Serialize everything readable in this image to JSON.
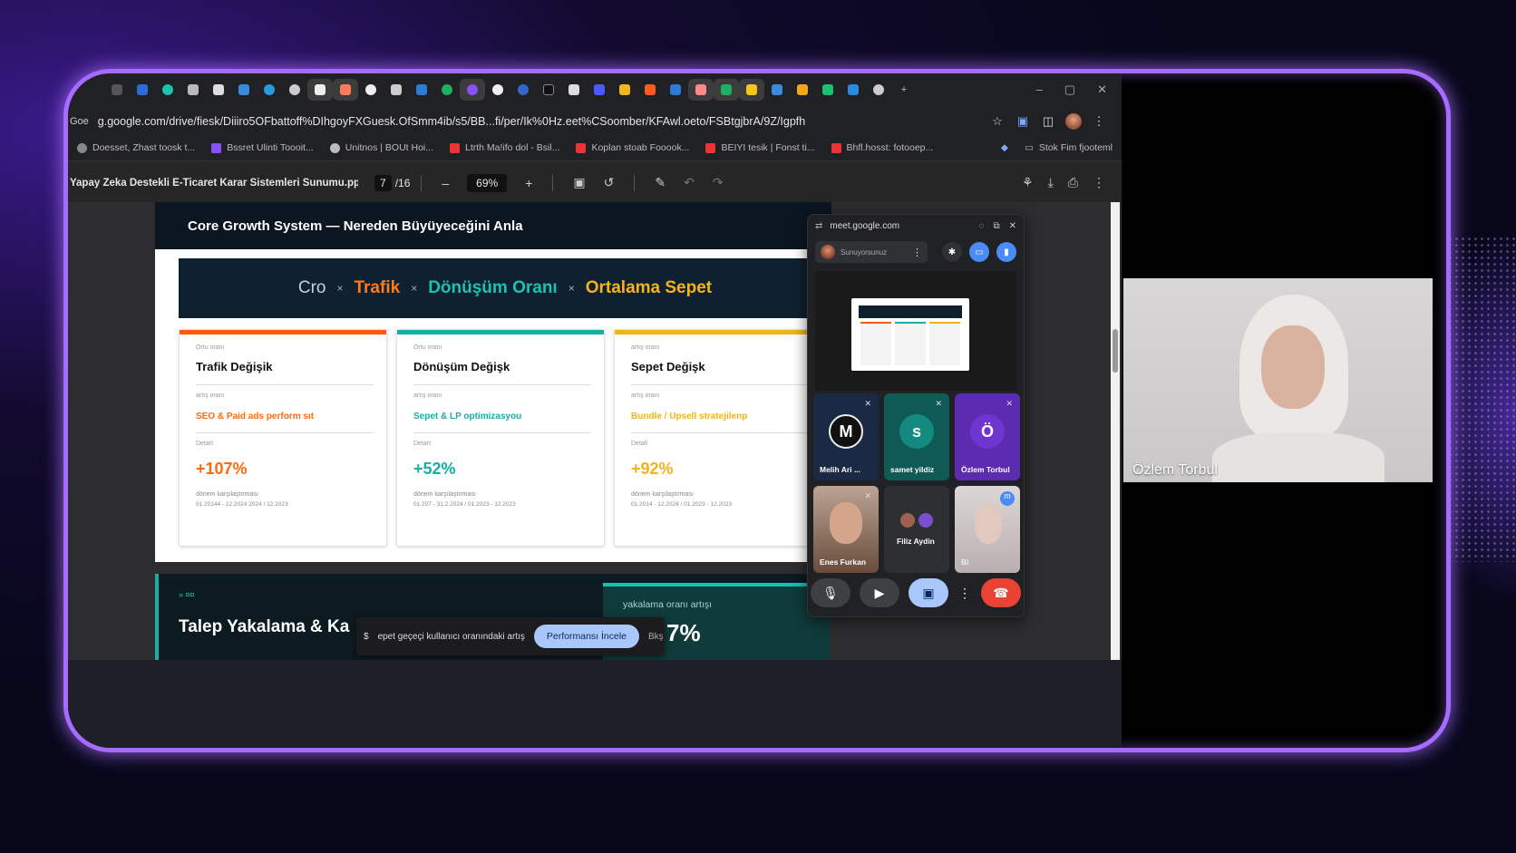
{
  "browser": {
    "url": "g.google.com/drive/fiesk/Diiiro5OFbattoff%DIhgoyFXGuesk.OfSmm4ib/s5/BB...fi/per/Ik%0Hz.eet%CSoomber/KFAwl.oeto/FSBtgjbrA/9Z/Igpfh",
    "url_prefix": "Goe",
    "bookmarks": [
      {
        "label": "Doesset, Zhast toosk t...",
        "color": "#888"
      },
      {
        "label": "Bssret Ulinti Toooit...",
        "color": "#8a4fff"
      },
      {
        "label": "Unitnos | BOUt Hoi...",
        "color": "#999"
      },
      {
        "label": "Ltrth Ma!ifo dol - Bsil...",
        "color": "#e33"
      },
      {
        "label": "Koplan stoab Fooook...",
        "color": "#e33"
      },
      {
        "label": "BEIYI tesik | Fonst ti...",
        "color": "#e33"
      },
      {
        "label": "Bhfl.hosst: fotooep...",
        "color": "#e33"
      }
    ],
    "bookmarks_right": "Stok Fim fjooteml"
  },
  "pdf": {
    "title": "Yapay Zeka Destekli E-Ticaret Karar Sistemleri Sunumu.pptx",
    "page_current": "7",
    "page_total": "/16",
    "zoom": "69%"
  },
  "slide": {
    "header": "Core Growth System — Nereden Büyüyeceğini Anla",
    "formula": {
      "cro": "Cro",
      "x": "×",
      "trafik": "Trafik",
      "donusum": "Dönüşüm Oranı",
      "sepet": "Ortalama Sepet"
    },
    "cards": [
      {
        "tiny": "Ortu oranı",
        "title": "Trafik Değişik",
        "sub_tiny": "artış oranı",
        "sub": "SEO & Paid ads perform sıt",
        "sub_color": "#ff6a10",
        "val_tiny": "Detart",
        "value": "+107%",
        "value_color": "#ff6a10",
        "note": "dönem karşılaştırması",
        "dates": "01.20144 - 12.2024 2024 / 12.2023",
        "bar": "#ff5a10"
      },
      {
        "tiny": "Ortu oranı",
        "title": "Dönüşüm Değişk",
        "sub_tiny": "artış oranı",
        "sub": "Sepet & LP optimizasyou",
        "sub_color": "#14b0a4",
        "val_tiny": "Detart",
        "value": "+52%",
        "value_color": "#14b0a4",
        "note": "dönem karşılaştırması",
        "dates": "01.207 - 31.2.2024 / 01.2023 - 12.2023",
        "bar": "#14b0a4"
      },
      {
        "tiny": "artış oranı",
        "title": "Sepet Değişk",
        "sub_tiny": "artış oranı",
        "sub": "Bundle / Upsell stratejilenp",
        "sub_color": "#f2b31a",
        "val_tiny": "Detall",
        "value": "+92%",
        "value_color": "#f2b31a",
        "note": "dönem karşılaştırması",
        "dates": "01.2014 - 12.2024 / 01.2023 - 12.2023",
        "bar": "#f2b31a"
      }
    ],
    "next": {
      "tag": "» ¤¤",
      "title": "Talep Yakalama & Ka",
      "right_label": "yakalama oranı artışı",
      "right_value": "7%"
    }
  },
  "toast": {
    "text": "epet geçeçi kullanıcı oranındaki artış",
    "button": "Performansı İncele",
    "dismiss": "Bkş"
  },
  "meet": {
    "domain": "meet.google.com",
    "presenter_label": "Sunuyorsunuz",
    "participants": [
      {
        "name": "Melih Ari ...",
        "initial": "M",
        "bg": "#1b2a44",
        "avatar_bg": "#111"
      },
      {
        "name": "samet yildiz",
        "initial": "s",
        "bg": "#0f5a55",
        "avatar_bg": "#138a80"
      },
      {
        "name": "Özlem Torbul",
        "initial": "Ö",
        "bg": "#5b2bb0",
        "avatar_bg": "#6e35d0"
      },
      {
        "name": "Enes Furkan",
        "initial": "",
        "bg": "#8a6a5a",
        "avatar_bg": ""
      },
      {
        "name": "Filiz Aydin",
        "initial": "",
        "bg": "#2e2f33",
        "avatar_bg": ""
      },
      {
        "name": "Bi",
        "initial": "",
        "bg": "#cfc9c8",
        "avatar_bg": ""
      }
    ]
  },
  "webcam": {
    "name": "Özlem Torbul"
  },
  "colors": {
    "frame": "#a56cff",
    "end_call": "#ea4335",
    "present_active": "#a8c7fa"
  }
}
